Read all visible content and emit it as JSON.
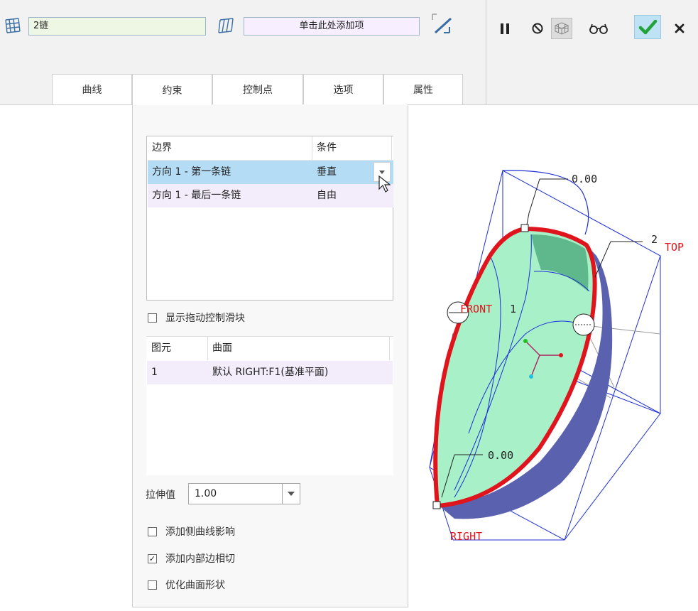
{
  "toolbar": {
    "chain_field_value": "2链",
    "add_field_placeholder": "单击此处添加项",
    "icons": [
      "boundary-surface-icon",
      "second-direction-icon",
      "toggle-direction-icon",
      "pause-icon",
      "no-preview-icon",
      "mesh-preview-icon",
      "glasses-preview-icon",
      "checkmark-icon",
      "close-icon"
    ],
    "accent_color": "#bfe3f5"
  },
  "tabs": [
    {
      "label": "曲线"
    },
    {
      "label": "约束"
    },
    {
      "label": "控制点"
    },
    {
      "label": "选项"
    },
    {
      "label": "属性"
    }
  ],
  "active_tab": "约束",
  "constraints": {
    "header_boundary": "边界",
    "header_condition": "条件",
    "rows": [
      {
        "boundary": "方向 1 - 第一条链",
        "condition": "垂直",
        "selected": true
      },
      {
        "boundary": "方向 1 - 最后一条链",
        "condition": "自由",
        "selected": false
      }
    ],
    "show_drag_handles_label": "显示拖动控制滑块",
    "show_drag_handles_checked": false,
    "entity_header": "图元",
    "surface_header": "曲面",
    "entity_rows": [
      {
        "entity": "1",
        "surface": "默认 RIGHT:F1(基准平面)"
      }
    ],
    "stretch_label": "拉伸值",
    "stretch_value": "1.00",
    "options": [
      {
        "label": "添加侧曲线影响",
        "checked": false
      },
      {
        "label": "添加内部边相切",
        "checked": true
      },
      {
        "label": "优化曲面形状",
        "checked": false
      }
    ]
  },
  "viewport": {
    "dimension_top": "0.00",
    "dimension_bottom": "0.00",
    "datum_top": "TOP",
    "datum_front": "FRONT",
    "datum_right": "RIGHT",
    "label_2": "2",
    "label_1": "1",
    "surface_color": "#a8f0c8",
    "boundary_color": "#e0141c",
    "datum_color": "#e0141c"
  }
}
